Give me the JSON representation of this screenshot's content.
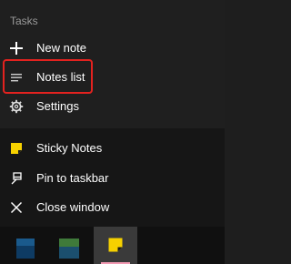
{
  "jumplist": {
    "group_title": "Tasks",
    "tasks": [
      {
        "label": "New note",
        "icon": "plus-icon"
      },
      {
        "label": "Notes list",
        "icon": "list-icon"
      },
      {
        "label": "Settings",
        "icon": "gear-icon"
      }
    ],
    "app_items": [
      {
        "label": "Sticky Notes",
        "icon": "sticky-notes-app-icon"
      },
      {
        "label": "Pin to taskbar",
        "icon": "pin-icon"
      },
      {
        "label": "Close window",
        "icon": "close-icon"
      }
    ]
  },
  "taskbar": {
    "icons": [
      {
        "name": "taskbar-app-icon-blue",
        "color": "#1a5a8c"
      },
      {
        "name": "taskbar-app-icon-green",
        "color": "#3f7a3a"
      },
      {
        "name": "taskbar-sticky-notes-icon",
        "color": "#f6d100"
      }
    ]
  },
  "colors": {
    "highlight_border": "#e3221f",
    "sticky_yellow": "#f6d100",
    "active_indicator": "#f29ab3"
  }
}
